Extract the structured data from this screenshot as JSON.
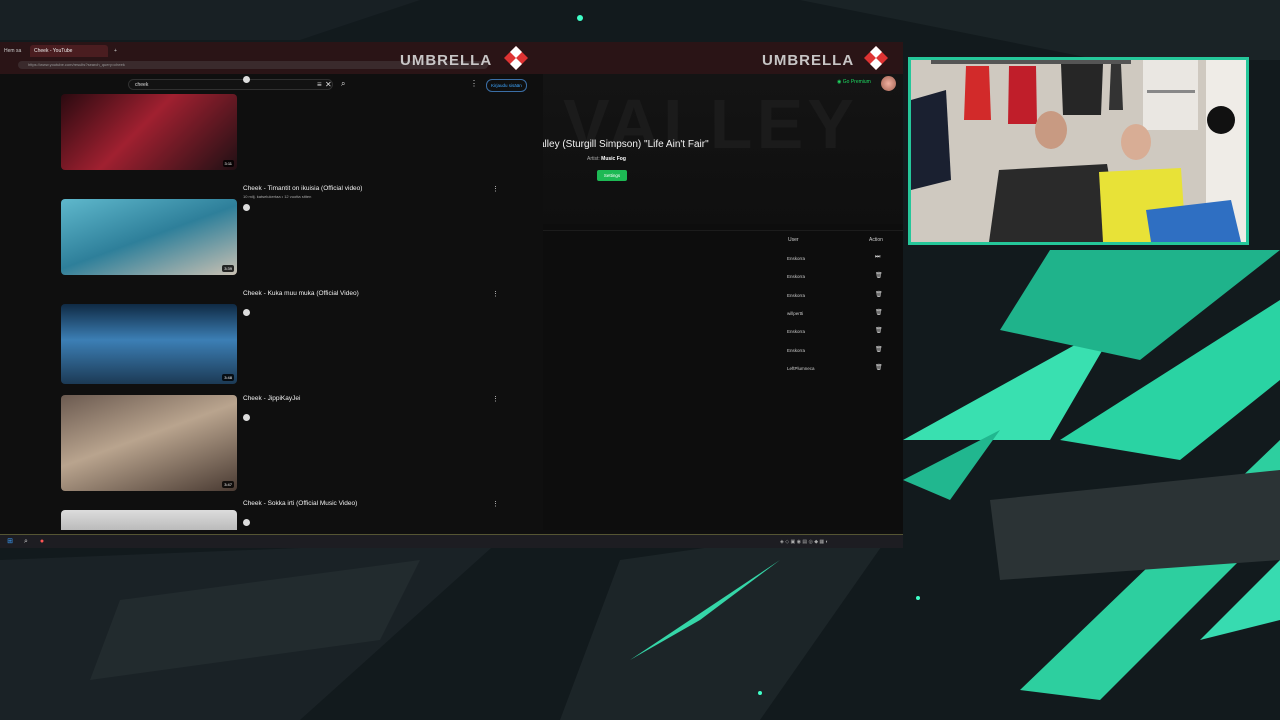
{
  "browser": {
    "tabs": [
      {
        "label": "Hem sa"
      },
      {
        "label": "Cheek - YouTube"
      }
    ],
    "address": "https://www.youtube.com/results?search_query=cheek",
    "brand": "UMBRELLA"
  },
  "youtube": {
    "search_value": "cheek",
    "signin_label": "Kirjaudu sisään",
    "videos": [
      {
        "title": "",
        "meta": "",
        "channel": "",
        "desc": "",
        "duration": "3:11"
      },
      {
        "title": "Cheek - Timantit on ikuisia (Official video)",
        "meta": "10 milj. katselukertaa • 12 vuotta sitten",
        "channel": "",
        "desc": "",
        "duration": "3:39"
      },
      {
        "title": "Cheek - Kuka muu muka (Official Video)",
        "meta": "",
        "channel": "",
        "desc": "",
        "duration": "3:48"
      },
      {
        "title": "Cheek - JippiKayJei",
        "meta": "",
        "channel": "",
        "desc": "",
        "duration": "3:47"
      },
      {
        "title": "Cheek - Sokka irti (Official Music Video)",
        "meta": "",
        "channel": "",
        "desc": "",
        "duration": ""
      }
    ]
  },
  "player": {
    "hero_bg_text": "VALLEY",
    "song_title": "alley (Sturgill Simpson) \"Life Ain't Fair\"",
    "artist_label": "Artist:",
    "artist_name": "Music Fog",
    "settings_label": "Settings",
    "premium_label": "Go Premium",
    "columns": {
      "user": "User",
      "action": "Action"
    },
    "queue": [
      {
        "user": "Enskorra",
        "action_icon": "skip-icon",
        "action_glyph": "⏭"
      },
      {
        "user": "Enskorra",
        "action_icon": "trash-icon",
        "action_glyph": "🗑"
      },
      {
        "user": "Enskorra",
        "action_icon": "trash-icon",
        "action_glyph": "🗑"
      },
      {
        "user": "willpertti",
        "action_icon": "trash-icon",
        "action_glyph": "🗑"
      },
      {
        "user": "Enskorra",
        "action_icon": "trash-icon",
        "action_glyph": "🗑"
      },
      {
        "user": "Enskorra",
        "action_icon": "trash-icon",
        "action_glyph": "🗑"
      },
      {
        "user": "LeftPlumneca",
        "action_icon": "trash-icon",
        "action_glyph": "🗑"
      }
    ]
  },
  "colors": {
    "accent": "#25c79a",
    "premium": "#1ed760",
    "settings": "#1db954"
  }
}
